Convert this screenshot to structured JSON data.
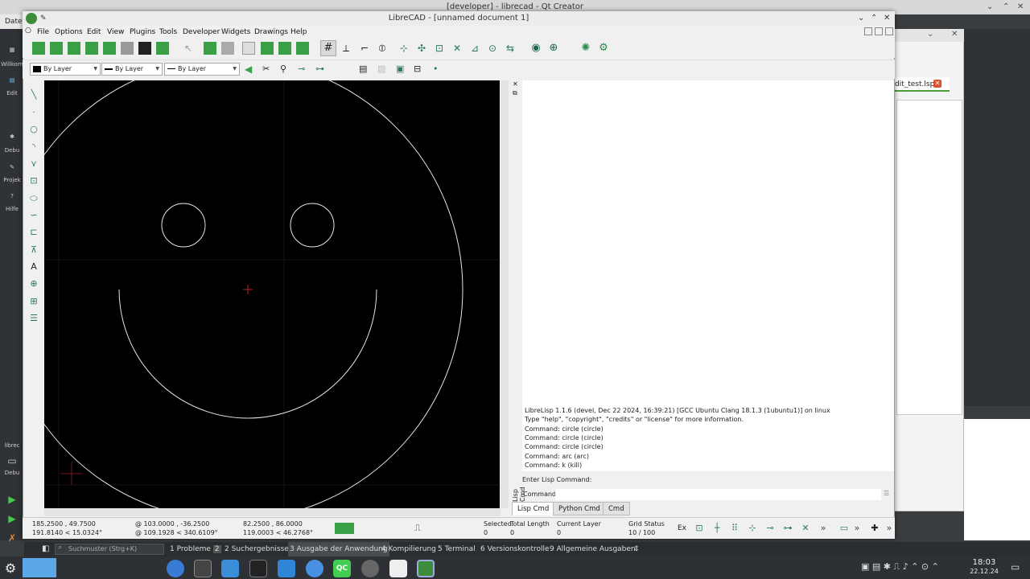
{
  "qt_creator": {
    "title": "[developer] - librecad - Qt Creator",
    "menu_first": "Datei",
    "left_modes": [
      "Willkom",
      "Edit",
      "Debu",
      "Projek",
      "Hilfe"
    ],
    "editor_tab": "dit_test.lsp",
    "left_bottom_label": "librec",
    "left_bottom_mode": "Debu",
    "search_placeholder": "Suchmuster (Strg+K)",
    "output_tabs": [
      "1 Probleme",
      "2 Suchergebnisse",
      "3 Ausgabe der Anwendung",
      "4 Kompilierung",
      "5 Terminal",
      "6 Versionskontrolle",
      "9 Allgemeine Ausgaben"
    ],
    "problems_badge": "2"
  },
  "taskbar": {
    "time": "18:03",
    "date": "22.12.24"
  },
  "librecad": {
    "title": "LibreCAD - [unnamed document 1]",
    "menu": [
      "File",
      "Options",
      "Edit",
      "View",
      "Plugins",
      "Tools",
      "Developer",
      "Widgets",
      "Drawings",
      "Help"
    ],
    "pen": {
      "color": "By Layer",
      "width": "By Layer",
      "type": "By Layer"
    },
    "lisp_output": [
      "LibreLisp 1.1.6 (devel, Dec 22 2024, 16:39:21) [GCC Ubuntu Clang 18.1.3 (1ubuntu1)] on linux",
      "Type \"help\", \"copyright\", \"credits\" or \"license\" for more information.",
      "Command: circle (circle)",
      "Command: circle (circle)",
      "Command: circle (circle)",
      "Command: arc (arc)",
      "Command: k (kill)"
    ],
    "lisp_prompt": "Enter Lisp Command:",
    "command_label": "Command:",
    "side_label": "Lisp Cmd",
    "dock_tabs": [
      "Lisp Cmd",
      "Python Cmd",
      "Cmd"
    ],
    "status": {
      "coord_abs1": "185.2500 , 49.7500",
      "coord_abs2": "191.8140 < 15.0324°",
      "coord_rel1": "@  103.0000 , -36.2500",
      "coord_rel2": "@  109.1928 < 340.6109°",
      "coord_3": "82.2500 , 86.0000",
      "coord_4": "119.0003 < 46.2768°",
      "selected_label": "Selected",
      "selected_value": "0",
      "total_length_label": "Total Length",
      "total_length_value": "0",
      "current_layer_label": "Current Layer",
      "current_layer_value": "0",
      "grid_label": "Grid Status",
      "grid_value": "10 / 100",
      "ex_label": "Ex"
    }
  }
}
